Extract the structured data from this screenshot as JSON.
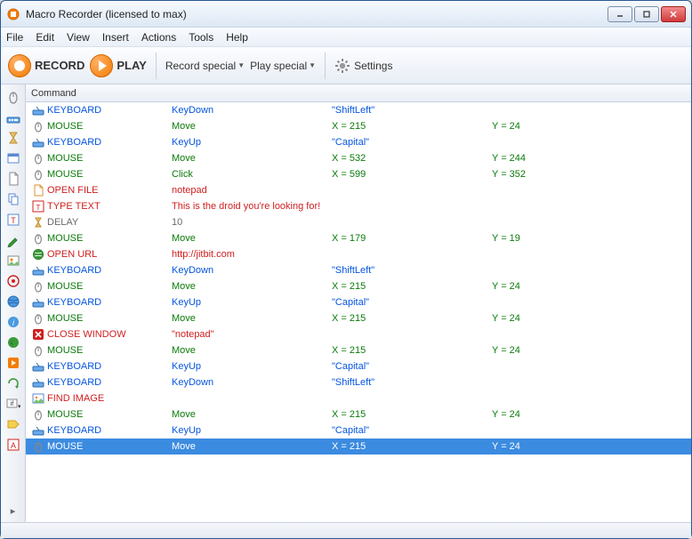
{
  "window": {
    "title": "Macro Recorder (licensed to max)"
  },
  "menus": [
    "File",
    "Edit",
    "View",
    "Insert",
    "Actions",
    "Tools",
    "Help"
  ],
  "toolbar": {
    "record": "RECORD",
    "play": "PLAY",
    "record_special": "Record special",
    "play_special": "Play special",
    "settings": "Settings"
  },
  "grid": {
    "header": "Command"
  },
  "rows": [
    {
      "icon": "kb",
      "cls": "c-kb",
      "c1": "KEYBOARD",
      "c2": "KeyDown",
      "c3": "\"ShiftLeft\"",
      "c4": "",
      "sel": false
    },
    {
      "icon": "mouse",
      "cls": "c-mouse",
      "c1": "MOUSE",
      "c2": "Move",
      "c3": "X = 215",
      "c4": "Y = 24",
      "sel": false
    },
    {
      "icon": "kb",
      "cls": "c-kb",
      "c1": "KEYBOARD",
      "c2": "KeyUp",
      "c3": "\"Capital\"",
      "c4": "",
      "sel": false
    },
    {
      "icon": "mouse",
      "cls": "c-mouse",
      "c1": "MOUSE",
      "c2": "Move",
      "c3": "X = 532",
      "c4": "Y = 244",
      "sel": false
    },
    {
      "icon": "mouse",
      "cls": "c-mouse",
      "c1": "MOUSE",
      "c2": "Click",
      "c3": "X = 599",
      "c4": "Y = 352",
      "sel": false
    },
    {
      "icon": "file",
      "cls": "c-cmd",
      "c1": "OPEN FILE",
      "c2": "notepad",
      "c3": "",
      "c4": "",
      "sel": false
    },
    {
      "icon": "text",
      "cls": "c-cmd",
      "c1": "TYPE TEXT",
      "c2": "This is the droid you're looking for!",
      "c3": "",
      "c4": "",
      "sel": false
    },
    {
      "icon": "delay",
      "cls": "c-delay",
      "c1": "DELAY",
      "c2": "10",
      "c3": "",
      "c4": "",
      "sel": false
    },
    {
      "icon": "mouse",
      "cls": "c-mouse",
      "c1": "MOUSE",
      "c2": "Move",
      "c3": "X = 179",
      "c4": "Y = 19",
      "sel": false
    },
    {
      "icon": "url",
      "cls": "c-cmd",
      "c1": "OPEN URL",
      "c2": "http://jitbit.com",
      "c3": "",
      "c4": "",
      "sel": false
    },
    {
      "icon": "kb",
      "cls": "c-kb",
      "c1": "KEYBOARD",
      "c2": "KeyDown",
      "c3": "\"ShiftLeft\"",
      "c4": "",
      "sel": false
    },
    {
      "icon": "mouse",
      "cls": "c-mouse",
      "c1": "MOUSE",
      "c2": "Move",
      "c3": "X = 215",
      "c4": "Y = 24",
      "sel": false
    },
    {
      "icon": "kb",
      "cls": "c-kb",
      "c1": "KEYBOARD",
      "c2": "KeyUp",
      "c3": "\"Capital\"",
      "c4": "",
      "sel": false
    },
    {
      "icon": "mouse",
      "cls": "c-mouse",
      "c1": "MOUSE",
      "c2": "Move",
      "c3": "X = 215",
      "c4": "Y = 24",
      "sel": false
    },
    {
      "icon": "close",
      "cls": "c-cmd",
      "c1": "CLOSE WINDOW",
      "c2": "\"notepad\"",
      "c3": "",
      "c4": "",
      "sel": false
    },
    {
      "icon": "mouse",
      "cls": "c-mouse",
      "c1": "MOUSE",
      "c2": "Move",
      "c3": "X = 215",
      "c4": "Y = 24",
      "sel": false
    },
    {
      "icon": "kb",
      "cls": "c-kb",
      "c1": "KEYBOARD",
      "c2": "KeyUp",
      "c3": "\"Capital\"",
      "c4": "",
      "sel": false
    },
    {
      "icon": "kb",
      "cls": "c-kb",
      "c1": "KEYBOARD",
      "c2": "KeyDown",
      "c3": "\"ShiftLeft\"",
      "c4": "",
      "sel": false
    },
    {
      "icon": "image",
      "cls": "c-cmd",
      "c1": "FIND IMAGE",
      "c2": "",
      "c3": "",
      "c4": "",
      "sel": false
    },
    {
      "icon": "mouse",
      "cls": "c-mouse",
      "c1": "MOUSE",
      "c2": "Move",
      "c3": "X = 215",
      "c4": "Y = 24",
      "sel": false
    },
    {
      "icon": "kb",
      "cls": "c-kb",
      "c1": "KEYBOARD",
      "c2": "KeyUp",
      "c3": "\"Capital\"",
      "c4": "",
      "sel": false
    },
    {
      "icon": "mouse",
      "cls": "c-mouse",
      "c1": "MOUSE",
      "c2": "Move",
      "c3": "X = 215",
      "c4": "Y = 24",
      "sel": true
    }
  ],
  "side_icons": [
    "mouse-icon",
    "keyboard-icon",
    "delay-icon",
    "window-icon",
    "file-icon",
    "copy-icon",
    "text-icon",
    "picker-icon",
    "image-icon",
    "target-icon",
    "globe-icon",
    "info-icon",
    "world-icon",
    "run-icon",
    "repeat-icon",
    "if-icon",
    "label-icon",
    "font-icon"
  ]
}
